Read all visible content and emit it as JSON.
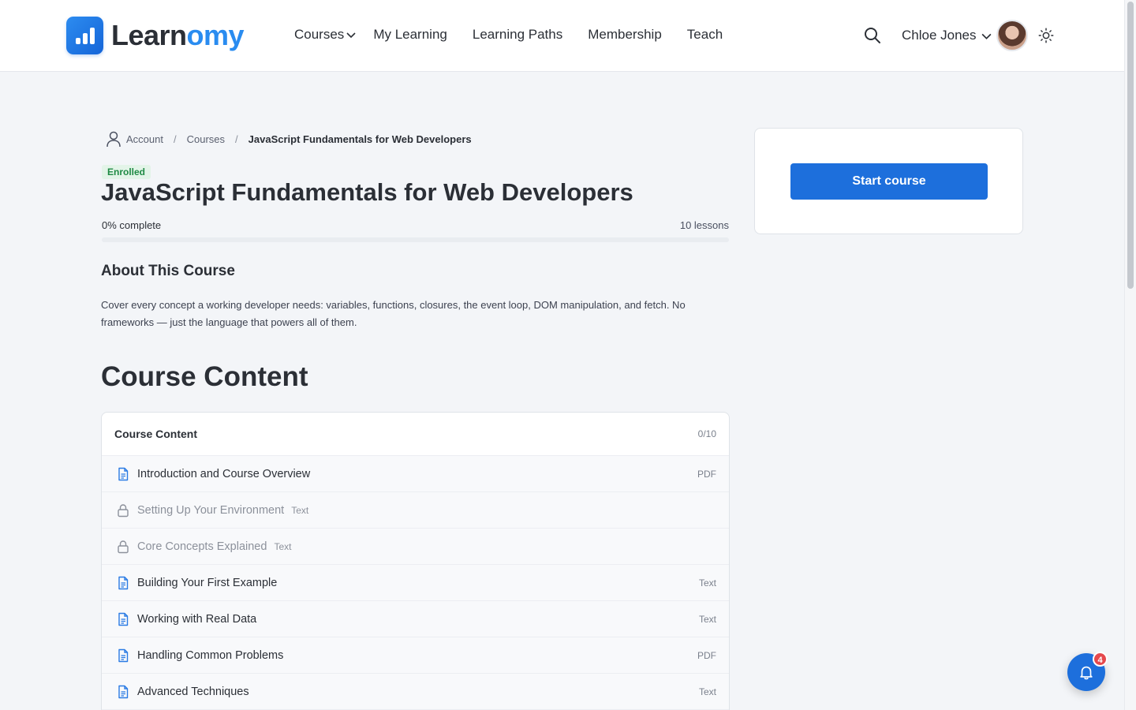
{
  "brand": {
    "name_part1": "Learn",
    "name_part2": "omy",
    "accent": "#2a8cf0"
  },
  "nav": {
    "items": [
      {
        "label": "Courses",
        "has_dropdown": true
      },
      {
        "label": "My Learning"
      },
      {
        "label": "Learning Paths"
      },
      {
        "label": "Membership"
      },
      {
        "label": "Teach"
      }
    ]
  },
  "header": {
    "search_icon": "search-icon",
    "user_name": "Chloe Jones",
    "theme_icon": "sun-icon"
  },
  "breadcrumb": {
    "items": [
      "Account",
      "Courses",
      "JavaScript Fundamentals for Web Developers"
    ],
    "separator": "/"
  },
  "course": {
    "status_badge": "Enrolled",
    "title": "JavaScript Fundamentals for Web Developers",
    "progress_label": "0% complete",
    "progress_fraction": 0,
    "lessons_count_label": "10 lessons"
  },
  "about": {
    "heading": "About This Course",
    "body": "Cover every concept a working developer needs: variables, functions, closures, the event loop, DOM manipulation, and fetch. No frameworks — just the language that powers all of them."
  },
  "content": {
    "heading": "Course Content",
    "card_title": "Course Content",
    "count": "0/10",
    "lessons": [
      {
        "title": "Introduction and Course Overview",
        "type": "PDF",
        "locked": false
      },
      {
        "title": "Setting Up Your Environment",
        "type": "Text",
        "locked": true
      },
      {
        "title": "Core Concepts Explained",
        "type": "Text",
        "locked": true
      },
      {
        "title": "Building Your First Example",
        "type": "Text",
        "locked": false
      },
      {
        "title": "Working with Real Data",
        "type": "Text",
        "locked": false
      },
      {
        "title": "Handling Common Problems",
        "type": "PDF",
        "locked": false
      },
      {
        "title": "Advanced Techniques",
        "type": "Text",
        "locked": false
      }
    ]
  },
  "sidebar": {
    "start_button": "Start course"
  },
  "notifications": {
    "count": "4"
  },
  "colors": {
    "primary": "#1d6fdc",
    "enrolled_bg": "#e3f4e8",
    "enrolled_text": "#1f8a44",
    "badge_red": "#e5484d"
  }
}
